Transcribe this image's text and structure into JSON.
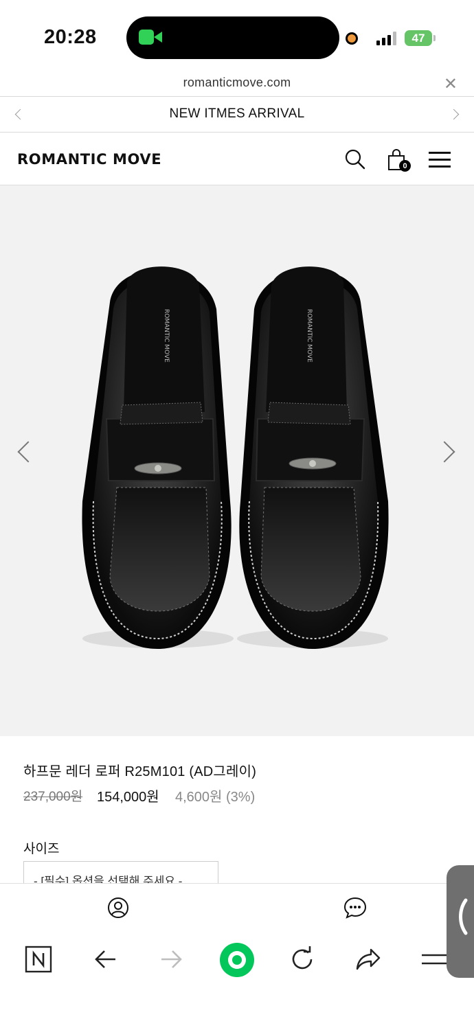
{
  "status_bar": {
    "time": "20:28",
    "battery": "47"
  },
  "browser": {
    "url": "romanticmove.com",
    "close_icon": "close-icon"
  },
  "announcement": {
    "text": "NEW ITMES ARRIVAL"
  },
  "header": {
    "logo": "ROMANTIC MOVE",
    "cart_count": "0"
  },
  "product": {
    "name": "하프문 레더 로퍼 R25M101 (AD그레이)",
    "original_price": "237,000원",
    "sale_price": "154,000원",
    "discount": "4,600원 (3%)",
    "size_label": "사이즈",
    "size_select_placeholder": "- [필수] 옵션을 선택해 주세요 -",
    "brand_on_insole": "ROMANTIC MOVE"
  },
  "colors": {
    "accent_green": "#31d158",
    "battery_green": "#65c466",
    "naver_green": "#03c75a",
    "bg_gallery": "#f2f2f2"
  }
}
